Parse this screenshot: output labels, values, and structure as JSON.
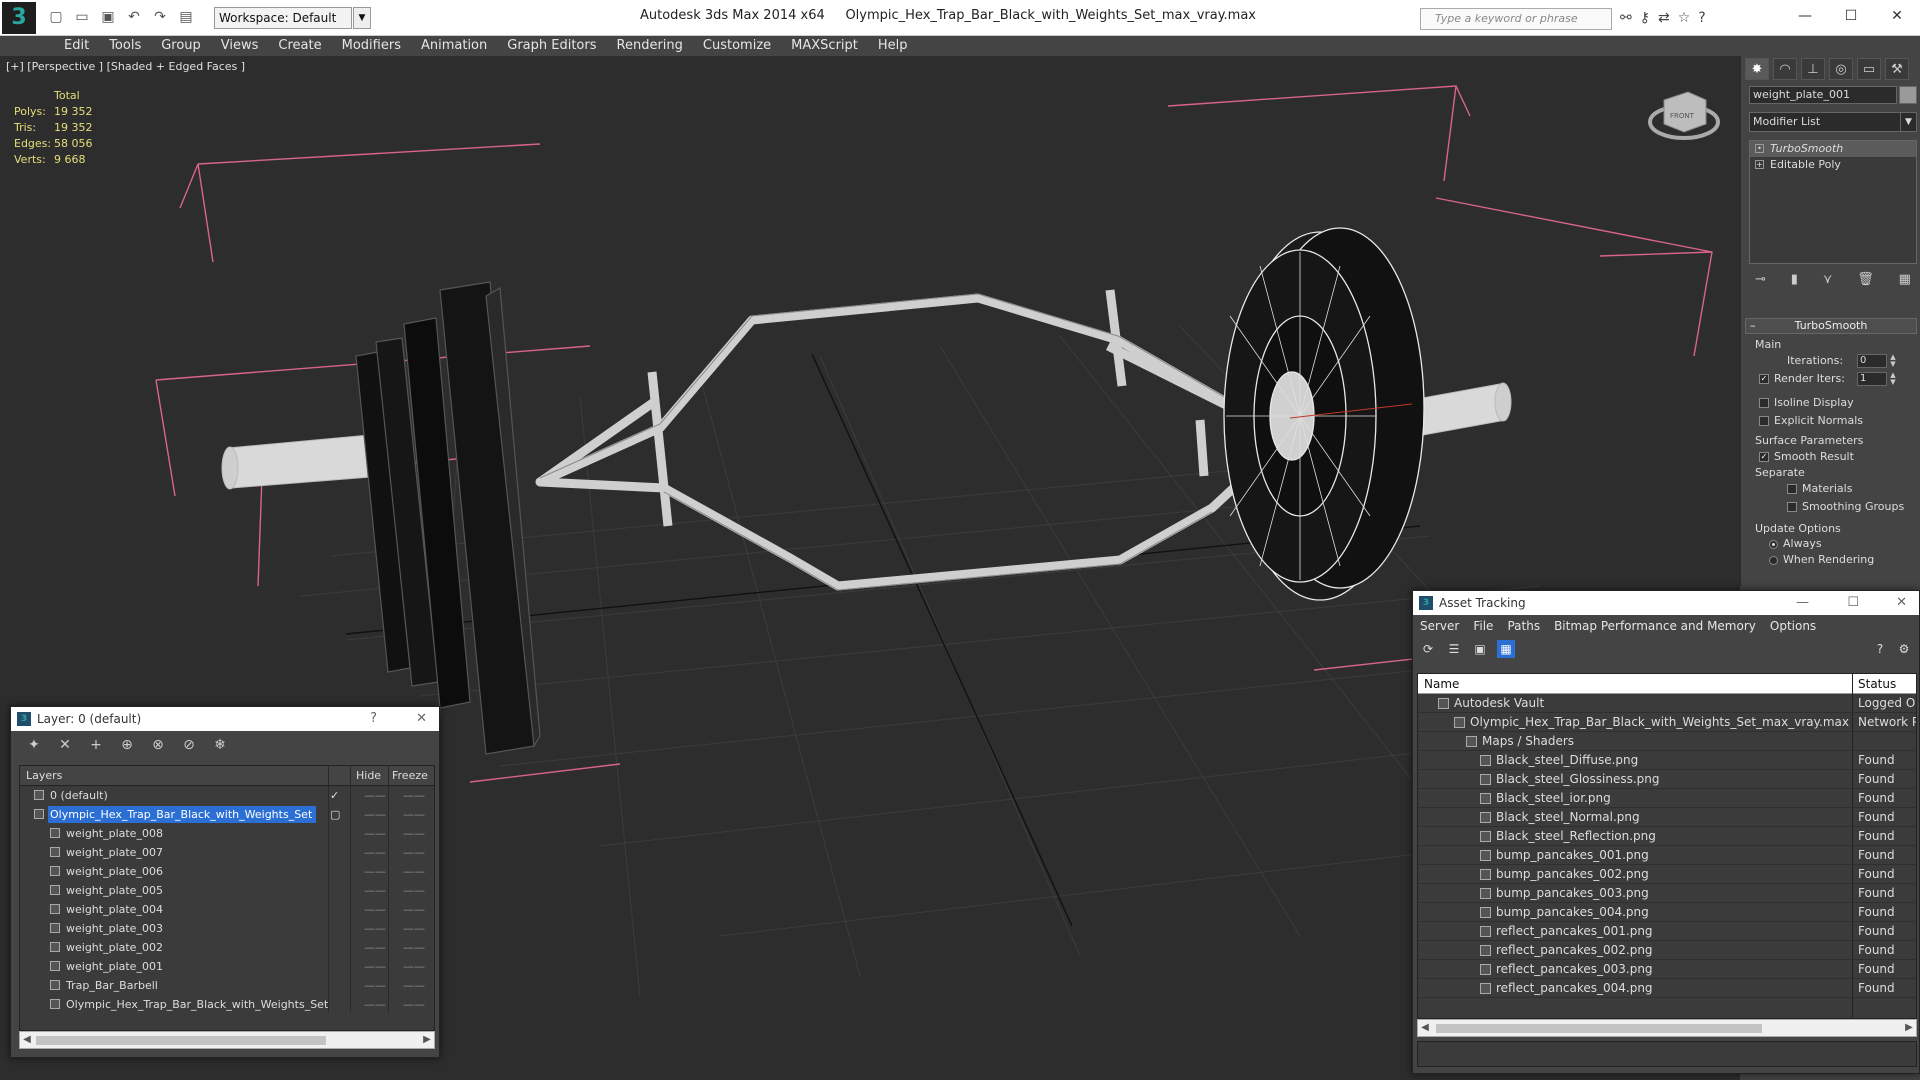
{
  "titlebar": {
    "workspace": "Workspace: Default",
    "app": "Autodesk 3ds Max  2014 x64",
    "file": "Olympic_Hex_Trap_Bar_Black_with_Weights_Set_max_vray.max",
    "search_placeholder": "Type a keyword or phrase"
  },
  "menu": [
    "Edit",
    "Tools",
    "Group",
    "Views",
    "Create",
    "Modifiers",
    "Animation",
    "Graph Editors",
    "Rendering",
    "Customize",
    "MAXScript",
    "Help"
  ],
  "viewport": {
    "label": "[+] [Perspective ] [Shaded + Edged Faces ]",
    "stats_header": "Total",
    "stats": [
      {
        "k": "Polys:",
        "v": "19 352"
      },
      {
        "k": "Tris:",
        "v": "19 352"
      },
      {
        "k": "Edges:",
        "v": "58 056"
      },
      {
        "k": "Verts:",
        "v": "9 668"
      }
    ],
    "viewcube": "FRONT"
  },
  "command_panel": {
    "object_name": "weight_plate_001",
    "modifier_list": "Modifier List",
    "stack": [
      "TurboSmooth",
      "Editable Poly"
    ],
    "rollout_title": "TurboSmooth",
    "main": "Main",
    "iterations_label": "Iterations:",
    "iterations_value": "0",
    "render_iters_label": "Render Iters:",
    "render_iters_value": "1",
    "isoline": "Isoline Display",
    "explicit_normals": "Explicit Normals",
    "surface_params": "Surface Parameters",
    "smooth_result": "Smooth Result",
    "separate": "Separate",
    "materials": "Materials",
    "smoothing_groups": "Smoothing Groups",
    "update_options": "Update Options",
    "always": "Always",
    "when_rendering": "When Rendering"
  },
  "layer_window": {
    "title": "Layer: 0 (default)",
    "col_layers": "Layers",
    "col_hide": "Hide",
    "col_freeze": "Freeze",
    "rows": [
      {
        "name": "0 (default)",
        "indent": 1,
        "type": "layer",
        "active": true
      },
      {
        "name": "Olympic_Hex_Trap_Bar_Black_with_Weights_Set",
        "indent": 1,
        "type": "layer",
        "selected": true
      },
      {
        "name": "weight_plate_008",
        "indent": 2,
        "type": "object"
      },
      {
        "name": "weight_plate_007",
        "indent": 2,
        "type": "object"
      },
      {
        "name": "weight_plate_006",
        "indent": 2,
        "type": "object"
      },
      {
        "name": "weight_plate_005",
        "indent": 2,
        "type": "object"
      },
      {
        "name": "weight_plate_004",
        "indent": 2,
        "type": "object"
      },
      {
        "name": "weight_plate_003",
        "indent": 2,
        "type": "object"
      },
      {
        "name": "weight_plate_002",
        "indent": 2,
        "type": "object"
      },
      {
        "name": "weight_plate_001",
        "indent": 2,
        "type": "object"
      },
      {
        "name": "Trap_Bar_Barbell",
        "indent": 2,
        "type": "object"
      },
      {
        "name": "Olympic_Hex_Trap_Bar_Black_with_Weights_Set",
        "indent": 2,
        "type": "object"
      }
    ]
  },
  "asset_window": {
    "title": "Asset Tracking",
    "menu": [
      "Server",
      "File",
      "Paths",
      "Bitmap Performance and Memory",
      "Options"
    ],
    "col_name": "Name",
    "col_status": "Status",
    "rows": [
      {
        "name": "Autodesk Vault",
        "indent": 1,
        "status": "Logged Out"
      },
      {
        "name": "Olympic_Hex_Trap_Bar_Black_with_Weights_Set_max_vray.max",
        "indent": 2,
        "status": "Network Path"
      },
      {
        "name": "Maps / Shaders",
        "indent": 3,
        "status": ""
      },
      {
        "name": "Black_steel_Diffuse.png",
        "indent": 4,
        "status": "Found"
      },
      {
        "name": "Black_steel_Glossiness.png",
        "indent": 4,
        "status": "Found"
      },
      {
        "name": "Black_steel_ior.png",
        "indent": 4,
        "status": "Found"
      },
      {
        "name": "Black_steel_Normal.png",
        "indent": 4,
        "status": "Found"
      },
      {
        "name": "Black_steel_Reflection.png",
        "indent": 4,
        "status": "Found"
      },
      {
        "name": "bump_pancakes_001.png",
        "indent": 4,
        "status": "Found"
      },
      {
        "name": "bump_pancakes_002.png",
        "indent": 4,
        "status": "Found"
      },
      {
        "name": "bump_pancakes_003.png",
        "indent": 4,
        "status": "Found"
      },
      {
        "name": "bump_pancakes_004.png",
        "indent": 4,
        "status": "Found"
      },
      {
        "name": "reflect_pancakes_001.png",
        "indent": 4,
        "status": "Found"
      },
      {
        "name": "reflect_pancakes_002.png",
        "indent": 4,
        "status": "Found"
      },
      {
        "name": "reflect_pancakes_003.png",
        "indent": 4,
        "status": "Found"
      },
      {
        "name": "reflect_pancakes_004.png",
        "indent": 4,
        "status": "Found"
      }
    ]
  },
  "colors": {
    "selection": "#2b6fd4",
    "stats_text": "#e6df7a",
    "bbox_pink": "#d9648a",
    "viewport_bg": "#2d2d2d"
  }
}
